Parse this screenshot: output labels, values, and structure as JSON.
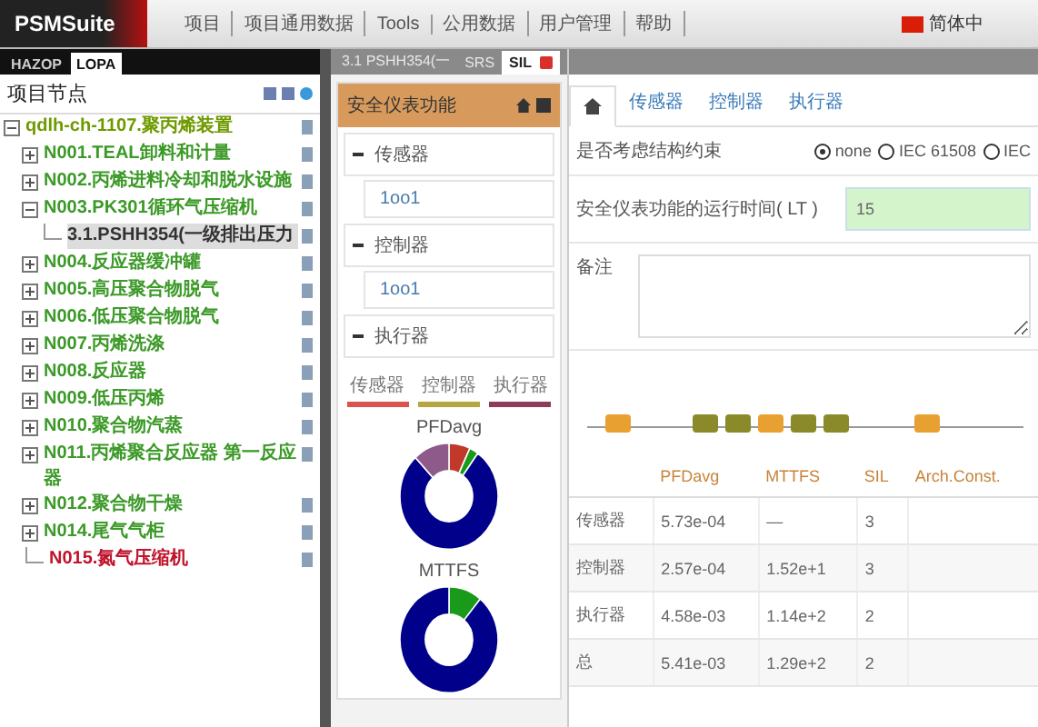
{
  "menu": {
    "logo": "PSMSuite",
    "items": [
      "项目",
      "项目通用数据",
      "Tools",
      "公用数据",
      "用户管理",
      "帮助"
    ],
    "language": "简体中"
  },
  "left": {
    "tabs": [
      {
        "label": "HAZOP",
        "selected": false
      },
      {
        "label": "LOPA",
        "selected": true
      }
    ],
    "title": "项目节点",
    "tree": [
      {
        "label": "qdlh-ch-1107.聚丙烯装置",
        "color": "#6f9a00",
        "expanded": true,
        "selected": false,
        "children": [
          {
            "label": "N001.TEAL卸料和计量",
            "color": "#3c9a28",
            "expanded": false,
            "selected": false
          },
          {
            "label": "N002.丙烯进料冷却和脱水设施",
            "color": "#3c9a28",
            "expanded": false,
            "selected": false
          },
          {
            "label": "N003.PK301循环气压缩机",
            "color": "#3c9a28",
            "expanded": true,
            "selected": false,
            "children": [
              {
                "label": "3.1.PSHH354(一级排出压力",
                "color": "#333333",
                "selected": true
              }
            ]
          },
          {
            "label": "N004.反应器缓冲罐",
            "color": "#3c9a28",
            "expanded": false,
            "selected": false
          },
          {
            "label": "N005.高压聚合物脱气",
            "color": "#3c9a28",
            "expanded": false,
            "selected": false
          },
          {
            "label": "N006.低压聚合物脱气",
            "color": "#3c9a28",
            "expanded": false,
            "selected": false
          },
          {
            "label": "N007.丙烯洗涤",
            "color": "#3c9a28",
            "expanded": false,
            "selected": false
          },
          {
            "label": "N008.反应器",
            "color": "#3c9a28",
            "expanded": false,
            "selected": false
          },
          {
            "label": "N009.低压丙烯",
            "color": "#3c9a28",
            "expanded": false,
            "selected": false
          },
          {
            "label": "N010.聚合物汽蒸",
            "color": "#3c9a28",
            "expanded": false,
            "selected": false
          },
          {
            "label": "N011.丙烯聚合反应器 第一反应器",
            "color": "#3c9a28",
            "expanded": false,
            "selected": false
          },
          {
            "label": "N012.聚合物干燥",
            "color": "#3c9a28",
            "expanded": false,
            "selected": false
          },
          {
            "label": "N014.尾气气柜",
            "color": "#3c9a28",
            "expanded": false,
            "selected": false
          },
          {
            "label": "N015.氮气压缩机",
            "color": "#c0142c",
            "selected": false
          }
        ]
      }
    ]
  },
  "middle": {
    "tabs": [
      {
        "label": "3.1 PSHH354(一",
        "selected": false,
        "closable": false
      },
      {
        "label": "SRS",
        "selected": false,
        "closable": false
      },
      {
        "label": "SIL",
        "selected": true,
        "closable": true
      }
    ],
    "header": "安全仪表功能",
    "groups": [
      {
        "label": "传感器",
        "expanded": true,
        "items": [
          "1oo1"
        ]
      },
      {
        "label": "控制器",
        "expanded": true,
        "items": [
          "1oo1"
        ]
      },
      {
        "label": "执行器",
        "expanded": true
      }
    ],
    "legend": [
      {
        "label": "传感器",
        "color": "#d9534f"
      },
      {
        "label": "控制器",
        "color": "#b5a642"
      },
      {
        "label": "执行器",
        "color": "#8e3a5a"
      }
    ],
    "donuts": [
      {
        "title": "PFDavg"
      },
      {
        "title": "MTTFS"
      }
    ]
  },
  "right": {
    "tabs": [
      {
        "kind": "home",
        "selected": true
      },
      {
        "kind": "text",
        "label": "传感器",
        "selected": false
      },
      {
        "kind": "text",
        "label": "控制器",
        "selected": false
      },
      {
        "kind": "text",
        "label": "执行器",
        "selected": false
      }
    ],
    "fields": [
      {
        "kind": "radio",
        "label": "是否考虑结构约束",
        "options": [
          {
            "label": "none",
            "selected": true
          },
          {
            "label": "IEC 61508",
            "selected": false
          },
          {
            "label": "IEC",
            "selected": false
          }
        ]
      },
      {
        "kind": "input",
        "label": "安全仪表功能的运行时间( LT )",
        "value": "15"
      },
      {
        "kind": "textarea",
        "label": "备注"
      }
    ],
    "table": {
      "columns": [
        "PFDavg",
        "MTTFS",
        "SIL",
        "Arch.Const."
      ],
      "rows": [
        {
          "name": "传感器",
          "cells": [
            "5.73e-04",
            "—",
            "3"
          ]
        },
        {
          "name": "控制器",
          "cells": [
            "2.57e-04",
            "1.52e+1",
            "3"
          ]
        },
        {
          "name": "执行器",
          "cells": [
            "4.58e-03",
            "1.14e+2",
            "2"
          ]
        },
        {
          "name": "总",
          "cells": [
            "5.41e-03",
            "1.29e+2",
            "2"
          ]
        }
      ]
    }
  }
}
